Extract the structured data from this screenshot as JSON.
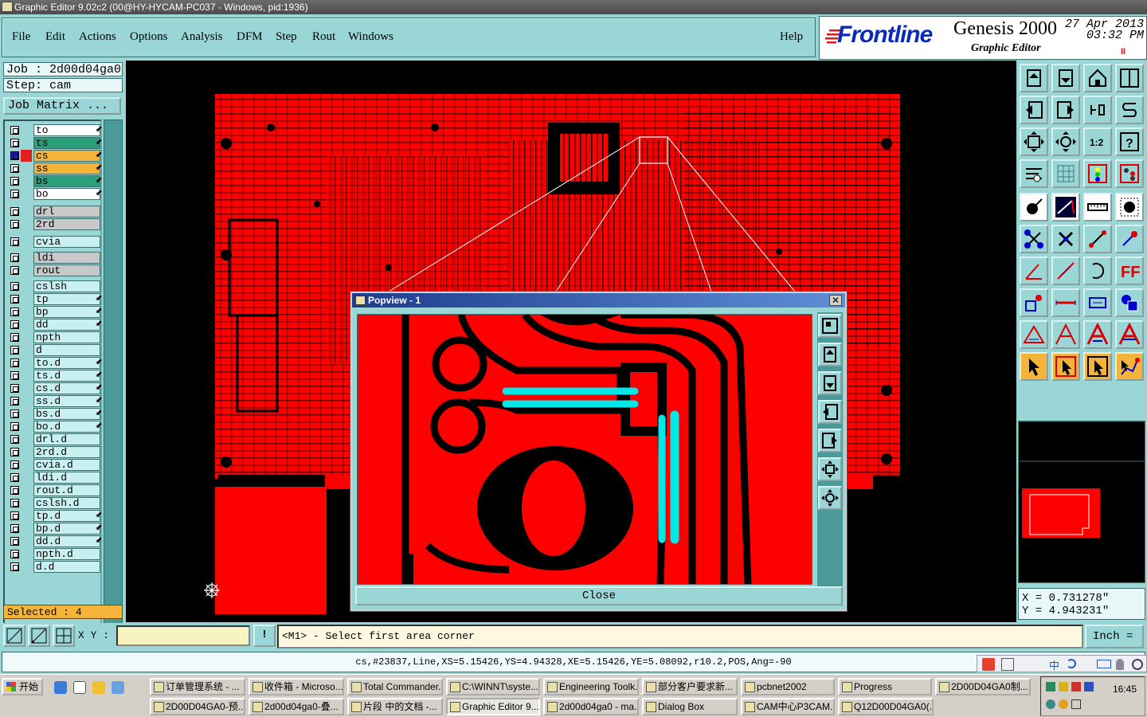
{
  "window": {
    "title": "Graphic Editor 9.02c2 (00@HY-HYCAM-PC037 - Windows, pid:1936)"
  },
  "menu": [
    "File",
    "Edit",
    "Actions",
    "Options",
    "Analysis",
    "DFM",
    "Step",
    "Rout",
    "Windows"
  ],
  "help": "Help",
  "brand": {
    "logo": "Frontline",
    "product": "Genesis 2000",
    "subtitle": "Graphic Editor",
    "date": "27 Apr 2013",
    "time": "03:32 PM",
    "pause": "II"
  },
  "job": {
    "job_label": "Job : 2d00d04ga0",
    "step_label": "Step: cam",
    "matrix_button": "Job Matrix ..."
  },
  "layers": [
    {
      "name": "to",
      "color": "#ffffff",
      "mark": "⬋"
    },
    {
      "name": "ts",
      "color": "#2aa07a",
      "mark": "⬋"
    },
    {
      "name": "cs",
      "color": "#f4b43a",
      "mark": "⬋",
      "active": true
    },
    {
      "name": "ss",
      "color": "#f4b43a",
      "mark": "⬋"
    },
    {
      "name": "bs",
      "color": "#2aa07a",
      "mark": "⬋"
    },
    {
      "name": "bo",
      "color": "#ffffff",
      "mark": "⬋"
    },
    {
      "name": "drl",
      "color": "#c8c8c8",
      "mark": ""
    },
    {
      "name": "2rd",
      "color": "#c8c8c8",
      "mark": ""
    },
    {
      "name": "cvia",
      "color": "#c8f0f0",
      "mark": ""
    },
    {
      "name": "ldi",
      "color": "#c8c8c8",
      "mark": ""
    },
    {
      "name": "rout",
      "color": "#c8c8c8",
      "mark": ""
    },
    {
      "name": "cslsh",
      "color": "#c8f0f0",
      "mark": ""
    },
    {
      "name": "tp",
      "color": "#c8f0f0",
      "mark": "⬋"
    },
    {
      "name": "bp",
      "color": "#c8f0f0",
      "mark": "⬋"
    },
    {
      "name": "dd",
      "color": "#c8f0f0",
      "mark": "⬋"
    },
    {
      "name": "npth",
      "color": "#c8f0f0",
      "mark": ""
    },
    {
      "name": "d",
      "color": "#c8f0f0",
      "mark": ""
    },
    {
      "name": "to.d",
      "color": "#c8f0f0",
      "mark": "⬋"
    },
    {
      "name": "ts.d",
      "color": "#c8f0f0",
      "mark": "⬋"
    },
    {
      "name": "cs.d",
      "color": "#c8f0f0",
      "mark": "⬋"
    },
    {
      "name": "ss.d",
      "color": "#c8f0f0",
      "mark": "⬋"
    },
    {
      "name": "bs.d",
      "color": "#c8f0f0",
      "mark": "⬋"
    },
    {
      "name": "bo.d",
      "color": "#c8f0f0",
      "mark": "⬋"
    },
    {
      "name": "drl.d",
      "color": "#c8f0f0",
      "mark": ""
    },
    {
      "name": "2rd.d",
      "color": "#c8f0f0",
      "mark": ""
    },
    {
      "name": "cvia.d",
      "color": "#c8f0f0",
      "mark": ""
    },
    {
      "name": "ldi.d",
      "color": "#c8f0f0",
      "mark": ""
    },
    {
      "name": "rout.d",
      "color": "#c8f0f0",
      "mark": ""
    },
    {
      "name": "cslsh.d",
      "color": "#c8f0f0",
      "mark": ""
    },
    {
      "name": "tp.d",
      "color": "#c8f0f0",
      "mark": "⬋"
    },
    {
      "name": "bp.d",
      "color": "#c8f0f0",
      "mark": "⬋"
    },
    {
      "name": "dd.d",
      "color": "#c8f0f0",
      "mark": "⬋"
    },
    {
      "name": "npth.d",
      "color": "#c8f0f0",
      "mark": ""
    },
    {
      "name": "d.d",
      "color": "#c8f0f0",
      "mark": ""
    }
  ],
  "selected_text": "Selected : 4",
  "popview": {
    "title": "Popview - 1",
    "close_x": "✕",
    "close_button": "Close"
  },
  "coords": {
    "x": "X = 0.731278\"",
    "y": "Y = 4.943231\""
  },
  "command": {
    "xy_label": "X Y :",
    "xy_value": "",
    "excl": "!",
    "message": "<M1> - Select first area corner",
    "unit": "Inch ="
  },
  "status_line": "cs,#23837,Line,XS=5.15426,YS=4.94328,XE=5.15426,YE=5.08092,r10.2,POS,Ang=-90",
  "taskbar": {
    "start": "开始",
    "row1": [
      "订单管理系统 - ...",
      "收件箱 - Microso...",
      "Total Commander...",
      "C:\\WINNT\\syste...",
      "Engineering Toolk...",
      "部分客户要求新...",
      "pcbnet2002",
      "Progress",
      "2D00D04GA0制..."
    ],
    "row2": [
      "2D00D04GA0-预...",
      "2d00d04ga0-叠...",
      "片段 中的文档 -...",
      "Graphic Editor 9....",
      "2d00d04ga0 - ma...",
      "Dialog Box",
      "CAM中心P3CAM...",
      "Q12D00D04GA0(..."
    ],
    "clock": "16:45"
  },
  "ime": {
    "lang": "中"
  },
  "colors": {
    "pcb": "#ff0000",
    "highlight": "#00e8e8",
    "panel": "#9ad6d6",
    "canvas": "#000000"
  }
}
